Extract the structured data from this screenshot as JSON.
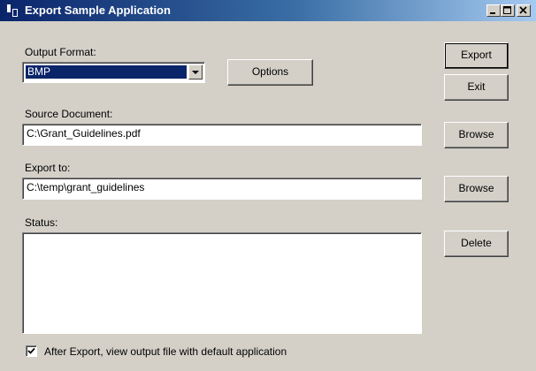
{
  "window": {
    "title": "Export Sample Application",
    "caption_buttons": {
      "minimize": "_",
      "maximize": "□",
      "close": "×"
    }
  },
  "output_format": {
    "label": "Output Format:",
    "selected": "BMP"
  },
  "buttons": {
    "options": "Options",
    "export": "Export",
    "exit": "Exit",
    "browse_source": "Browse",
    "browse_export": "Browse",
    "delete": "Delete"
  },
  "source_document": {
    "label": "Source Document:",
    "value": "C:\\Grant_Guidelines.pdf"
  },
  "export_to": {
    "label": "Export to:",
    "value": "C:\\temp\\grant_guidelines"
  },
  "status": {
    "label": "Status:",
    "value": ""
  },
  "view_after_export": {
    "label": "After Export, view output file with default application",
    "checked": true
  }
}
